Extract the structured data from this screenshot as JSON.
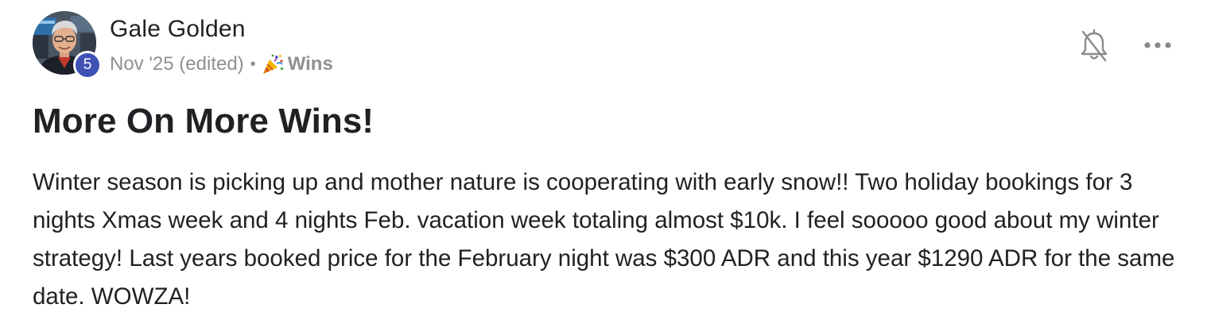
{
  "author": {
    "name": "Gale Golden",
    "level": "5"
  },
  "meta": {
    "date": "Nov '25 (edited)",
    "separator": "•",
    "category_icon": "party-popper-icon",
    "category": "Wins"
  },
  "actions": {
    "bell_icon": "bell-off-icon",
    "more_icon": "more-horizontal-icon"
  },
  "post": {
    "title": "More On More Wins!",
    "body": "Winter season is picking up and mother nature is cooperating with early snow!! Two holiday bookings for 3 nights Xmas week and 4 nights Feb. vacation week totaling almost $10k. I feel sooooo good about my winter strategy! Last years booked price for the February night was $300 ADR and this year $1290 ADR for the same date. WOWZA!"
  },
  "colors": {
    "badge": "#3f51b5",
    "meta_text": "#909090",
    "text": "#202124"
  }
}
